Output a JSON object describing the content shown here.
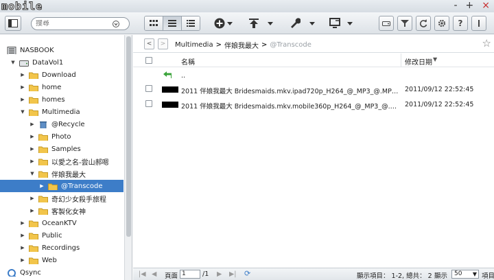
{
  "app": {
    "logo_text": "mobile",
    "window_controls": [
      "-",
      "+",
      "×"
    ]
  },
  "toolbar": {
    "search_placeholder": "搜尋"
  },
  "tree": [
    {
      "label": "NASBOOK",
      "level": 0,
      "icon": "server-icon",
      "toggle": ""
    },
    {
      "label": "DataVol1",
      "level": 1,
      "icon": "disk-icon",
      "toggle": "▼"
    },
    {
      "label": "Download",
      "level": 2,
      "icon": "folder-icon",
      "toggle": "▶"
    },
    {
      "label": "home",
      "level": 2,
      "icon": "folder-icon",
      "toggle": "▶"
    },
    {
      "label": "homes",
      "level": 2,
      "icon": "folder-icon",
      "toggle": "▶"
    },
    {
      "label": "Multimedia",
      "level": 2,
      "icon": "folder-open-icon",
      "toggle": "▼"
    },
    {
      "label": "@Recycle",
      "level": 3,
      "icon": "recycle-bin-icon",
      "toggle": "▶"
    },
    {
      "label": "Photo",
      "level": 3,
      "icon": "folder-icon",
      "toggle": "▶"
    },
    {
      "label": "Samples",
      "level": 3,
      "icon": "folder-icon",
      "toggle": "▶"
    },
    {
      "label": "以愛之名-尝山郝嗯",
      "level": 3,
      "icon": "folder-icon",
      "toggle": "▶"
    },
    {
      "label": "伴娘我最大",
      "level": 3,
      "icon": "folder-open-icon",
      "toggle": "▼"
    },
    {
      "label": "@Transcode",
      "level": 4,
      "icon": "folder-icon",
      "toggle": "▶",
      "selected": true
    },
    {
      "label": "奇幻少女殺手旅程",
      "level": 3,
      "icon": "folder-icon",
      "toggle": "▶"
    },
    {
      "label": "客製化女神",
      "level": 3,
      "icon": "folder-icon",
      "toggle": "▶"
    },
    {
      "label": "OceanKTV",
      "level": 2,
      "icon": "folder-icon",
      "toggle": "▶"
    },
    {
      "label": "Public",
      "level": 2,
      "icon": "folder-icon",
      "toggle": "▶"
    },
    {
      "label": "Recordings",
      "level": 2,
      "icon": "folder-icon",
      "toggle": "▶"
    },
    {
      "label": "Web",
      "level": 2,
      "icon": "folder-icon",
      "toggle": "▶"
    },
    {
      "label": "Qsync",
      "level": 0,
      "icon": "qsync-icon",
      "toggle": ""
    }
  ],
  "breadcrumb": {
    "items": [
      "Multimedia",
      "伴娘我最大",
      "@Transcode"
    ],
    "separator": ">"
  },
  "grid": {
    "col_name": "名稱",
    "col_date": "修改日期",
    "parent_label": "..",
    "rows": [
      {
        "name": "2011 伴娘我最大 Bridesmaids.mkv.ipad720p_H264_@_MP3_@.MPEG4...",
        "date": "2011/09/12 22:52:45"
      },
      {
        "name": "2011 伴娘我最大 Bridesmaids.mkv.mobile360p_H264_@_MP3_@.MPE...",
        "date": "2011/09/12 22:52:45"
      }
    ]
  },
  "status": {
    "page_label": "頁面",
    "page_value": "1",
    "page_total": "/1",
    "display_items": "顯示項目： 1-2, 總共： 2",
    "display_label": "顯示",
    "per_page": "50",
    "items_label": "項目"
  },
  "colors": {
    "selected": "#3d7dc8",
    "folder": "#f2c54b",
    "accent_close": "#c62828"
  }
}
